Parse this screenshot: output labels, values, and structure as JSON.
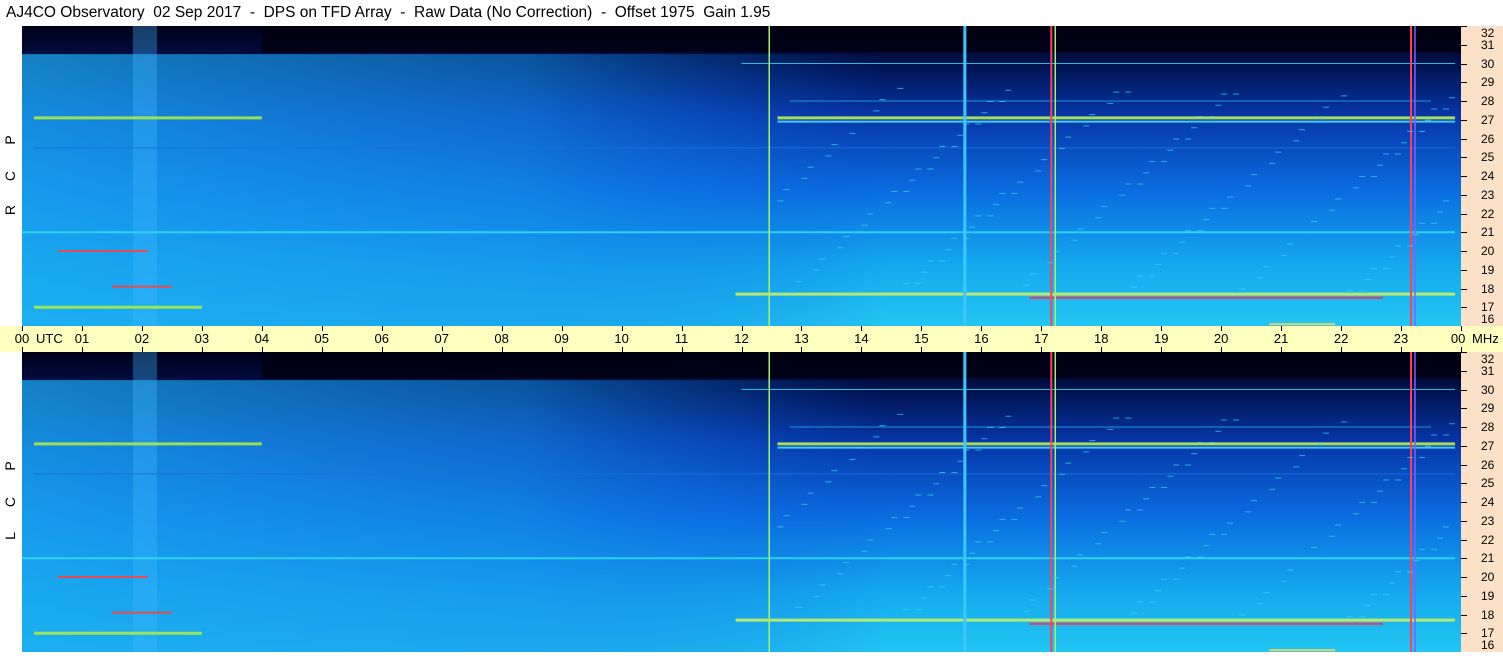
{
  "title": "AJ4CO Observatory  02 Sep 2017  -  DPS on TFD Array  -  Raw Data (No Correction)  -  Offset 1975  Gain 1.95",
  "panels": [
    {
      "label": "RCP",
      "letters": [
        "P",
        "C",
        "R"
      ]
    },
    {
      "label": "LCP",
      "letters": [
        "P",
        "C",
        "L"
      ]
    }
  ],
  "time_axis": {
    "labels": [
      "00",
      "01",
      "02",
      "03",
      "04",
      "05",
      "06",
      "07",
      "08",
      "09",
      "10",
      "11",
      "12",
      "13",
      "14",
      "15",
      "16",
      "17",
      "18",
      "19",
      "20",
      "21",
      "22",
      "23",
      "00"
    ],
    "utc_label": "UTC",
    "freq_unit": "MHz"
  },
  "chart_data": {
    "type": "heatmap",
    "title": "AJ4CO Observatory  02 Sep 2017  -  DPS on TFD Array  -  Raw Data (No Correction)  -  Offset 1975  Gain 1.95",
    "x_axis": {
      "label": "UTC",
      "range": [
        0,
        24
      ],
      "ticks": [
        "00",
        "01",
        "02",
        "03",
        "04",
        "05",
        "06",
        "07",
        "08",
        "09",
        "10",
        "11",
        "12",
        "13",
        "14",
        "15",
        "16",
        "17",
        "18",
        "19",
        "20",
        "21",
        "22",
        "23",
        "00"
      ]
    },
    "y_axis": {
      "label": "MHz",
      "range": [
        16,
        32
      ],
      "ticks": [
        16,
        17,
        18,
        19,
        20,
        21,
        22,
        23,
        24,
        25,
        26,
        27,
        28,
        29,
        30,
        31,
        32
      ]
    },
    "panels": [
      "RCP",
      "LCP"
    ],
    "colors": {
      "low": "#000020",
      "mid": "#0a6be0",
      "high": "#1fc4f0",
      "strong": "#a6e83c",
      "peak": "#ff3030"
    }
  },
  "colors": {
    "time_bar_bg": "#ffffc0",
    "right_axis_bg": "#fde0c8"
  }
}
